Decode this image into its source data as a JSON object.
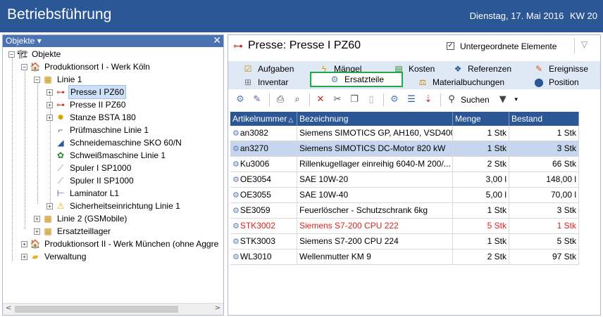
{
  "app": {
    "title": "Betriebsführung",
    "date": "Dienstag, 17. Mai 2016",
    "week": "KW 20"
  },
  "left_panel": {
    "header": "Objekte ▾",
    "close": "✕",
    "tree": [
      {
        "label": "Objekte",
        "icon": "objects-icon"
      },
      {
        "label": "Produktionsort I - Werk Köln",
        "icon": "location-icon"
      },
      {
        "label": "Linie 1",
        "icon": "line-icon"
      },
      {
        "label": "Presse I PZ60",
        "icon": "press-icon"
      },
      {
        "label": "Presse II PZ60",
        "icon": "press-icon"
      },
      {
        "label": "Stanze BSTA 180",
        "icon": "punch-icon"
      },
      {
        "label": "Prüfmaschine Linie 1",
        "icon": "test-machine-icon"
      },
      {
        "label": "Schneidemaschine SKO 60/N",
        "icon": "cutting-machine-icon"
      },
      {
        "label": "Schweißmaschine Linie 1",
        "icon": "welding-machine-icon"
      },
      {
        "label": "Spuler I SP1000",
        "icon": "spooler-icon"
      },
      {
        "label": "Spuler II SP1000",
        "icon": "spooler-icon"
      },
      {
        "label": "Laminator L1",
        "icon": "laminator-icon"
      },
      {
        "label": "Sicherheitseinrichtung Linie 1",
        "icon": "warning-icon"
      },
      {
        "label": "Linie 2 (GSMobile)",
        "icon": "line-icon"
      },
      {
        "label": "Ersatzteillager",
        "icon": "line-icon"
      },
      {
        "label": "Produktionsort II - Werk München (ohne Aggre",
        "icon": "location-icon"
      },
      {
        "label": "Verwaltung",
        "icon": "folder-icon"
      }
    ]
  },
  "right_panel": {
    "title": "Presse: Presse I PZ60",
    "checkbox_label": "Untergeordnete Elemente",
    "checkbox_mark": "✓",
    "tabs_row1": [
      "Aufgaben",
      "Mängel",
      "Kosten",
      "Referenzen",
      "Ereignisse"
    ],
    "tabs_row2": [
      "Inventar",
      "Ersatzteile",
      "Materialbuchungen",
      "Position"
    ],
    "active_tab": "Ersatzteile",
    "toolbar_search": "Suchen",
    "columns": [
      "Artikelnummer",
      "Bezeichnung",
      "Menge",
      "Bestand"
    ],
    "rows": [
      {
        "art": "an3082",
        "bez": "Siemens SIMOTICS GP, AH160, VSD400...",
        "menge": "1 Stk",
        "bestand": "1 Stk"
      },
      {
        "art": "an3270",
        "bez": "Siemens SIMOTICS DC-Motor 820 kW",
        "menge": "1 Stk",
        "bestand": "3 Stk"
      },
      {
        "art": "Ku3006",
        "bez": "Rillenkugellager einreihig 6040-M 200/...",
        "menge": "2 Stk",
        "bestand": "66 Stk"
      },
      {
        "art": "OE3054",
        "bez": "SAE 10W-20",
        "menge": "3,00 l",
        "bestand": "148,00 l"
      },
      {
        "art": "OE3055",
        "bez": "SAE 10W-40",
        "menge": "5,00 l",
        "bestand": "70,00 l"
      },
      {
        "art": "SE3059",
        "bez": "Feuerlöscher - Schutzschrank 6kg",
        "menge": "1 Stk",
        "bestand": "3 Stk"
      },
      {
        "art": "STK3002",
        "bez": "Siemens S7-200 CPU 222",
        "menge": "5 Stk",
        "bestand": "1 Stk"
      },
      {
        "art": "STK3003",
        "bez": "Siemens S7-200 CPU 224",
        "menge": "1 Stk",
        "bestand": "5 Stk"
      },
      {
        "art": "WL3010",
        "bez": "Wellenmutter KM 9",
        "menge": "2 Stk",
        "bestand": "97 Stk"
      }
    ]
  },
  "colors": {
    "titlebar": "#2b5797",
    "grid_header": "#2b5797",
    "active_tab_border": "#22a845",
    "selected_row": "#c5d6ee",
    "warning_text": "#e02020"
  }
}
